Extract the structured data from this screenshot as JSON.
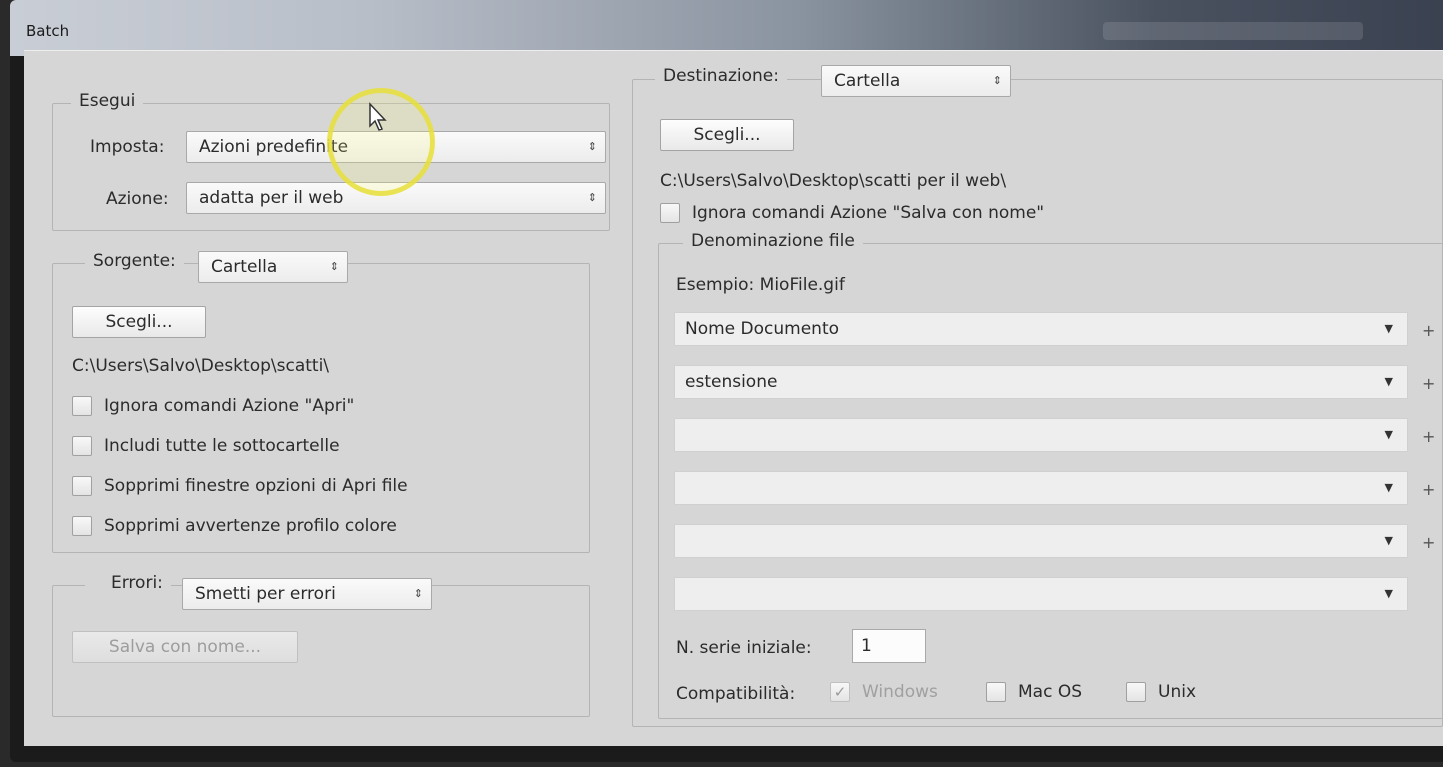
{
  "window": {
    "title": "Batch"
  },
  "esegui": {
    "legend": "Esegui",
    "imposta_label": "Imposta:",
    "imposta_value": "Azioni predefinite",
    "azione_label": "Azione:",
    "azione_value": "adatta per il web"
  },
  "sorgente": {
    "label": "Sorgente:",
    "value": "Cartella",
    "choose_button": "Scegli...",
    "path": "C:\\Users\\Salvo\\Desktop\\scatti\\",
    "options": [
      {
        "label": "Ignora comandi Azione \"Apri\"",
        "checked": false
      },
      {
        "label": "Includi tutte le sottocartelle",
        "checked": false
      },
      {
        "label": "Sopprimi finestre opzioni di Apri file",
        "checked": false
      },
      {
        "label": "Sopprimi avvertenze profilo colore",
        "checked": false
      }
    ]
  },
  "errori": {
    "label": "Errori:",
    "value": "Smetti per errori",
    "save_button": "Salva con nome..."
  },
  "destinazione": {
    "label": "Destinazione:",
    "value": "Cartella",
    "choose_button": "Scegli...",
    "path": "C:\\Users\\Salvo\\Desktop\\scatti per il web\\",
    "ignore_save": {
      "label": "Ignora comandi Azione \"Salva con nome\"",
      "checked": false
    }
  },
  "denominazione": {
    "legend": "Denominazione file",
    "example": "Esempio: MioFile.gif",
    "fields": [
      "Nome Documento",
      "estensione",
      "",
      "",
      "",
      ""
    ],
    "plus": "+",
    "serial_label": "N. serie iniziale:",
    "serial_value": "1",
    "compat_label": "Compatibilità:",
    "compat": [
      {
        "label": "Windows",
        "checked": true,
        "disabled": true
      },
      {
        "label": "Mac OS",
        "checked": false,
        "disabled": false
      },
      {
        "label": "Unix",
        "checked": false,
        "disabled": false
      }
    ]
  },
  "icons": {
    "select_arrows": "⇕",
    "dropdown": "▼",
    "check": "✓"
  }
}
